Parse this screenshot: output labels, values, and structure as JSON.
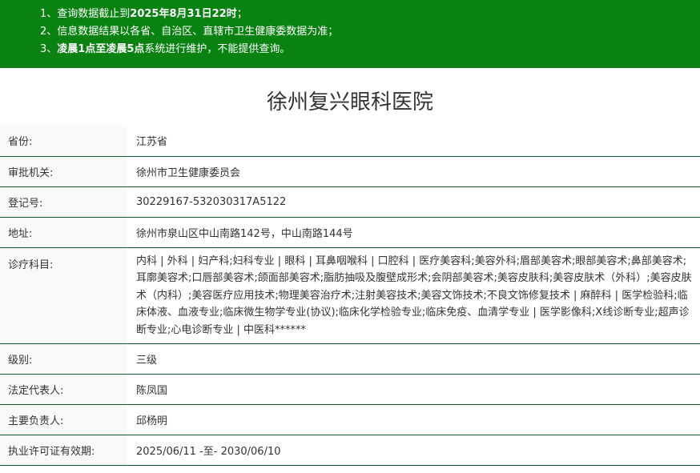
{
  "notice": {
    "line1_prefix": "1、查询数据截止到",
    "line1_bold": "2025年8月31日22时",
    "line1_suffix": "；",
    "line2": "2、信息数据结果以各省、自治区、直辖市卫生健康委数据为准；",
    "line3_prefix": "3、",
    "line3_bold": "凌晨1点至凌晨5点",
    "line3_suffix": "系统进行维护，不能提供查询。"
  },
  "hospital_name": "徐州复兴眼科医院",
  "fields": {
    "province": {
      "label": "省份:",
      "value": "江苏省"
    },
    "authority": {
      "label": "审批机关:",
      "value": "徐州市卫生健康委员会"
    },
    "reg_no": {
      "label": "登记号:",
      "value": "30229167-532030317A5122"
    },
    "address": {
      "label": "地址:",
      "value": "徐州市泉山区中山南路142号，中山南路144号"
    },
    "departments": {
      "label": "诊疗科目:",
      "value": "内科 | 外科 | 妇产科;妇科专业 | 眼科 | 耳鼻咽喉科 | 口腔科 | 医疗美容科;美容外科;眉部美容术;眼部美容术;鼻部美容术;耳廓美容术;口唇部美容术;颌面部美容术;脂肪抽吸及腹壁成形术;会阴部美容术;美容皮肤科;美容皮肤术（外科）;美容皮肤术（内科）;美容医疗应用技术;物理美容治疗术;注射美容技术;美容文饰技术;不良文饰修复技术 | 麻醉科 | 医学检验科;临床体液、血液专业;临床微生物学专业(协议);临床化学检验专业;临床免疫、血清学专业 | 医学影像科;X线诊断专业;超声诊断专业;心电诊断专业 | 中医科******"
    },
    "level": {
      "label": "级别:",
      "value": "三级"
    },
    "legal_rep": {
      "label": "法定代表人:",
      "value": "陈凤国"
    },
    "principal": {
      "label": "主要负责人:",
      "value": "邱杨明"
    },
    "license_valid": {
      "label": "执业许可证有效期:",
      "value": "2025/06/11 -至- 2030/06/10"
    }
  }
}
